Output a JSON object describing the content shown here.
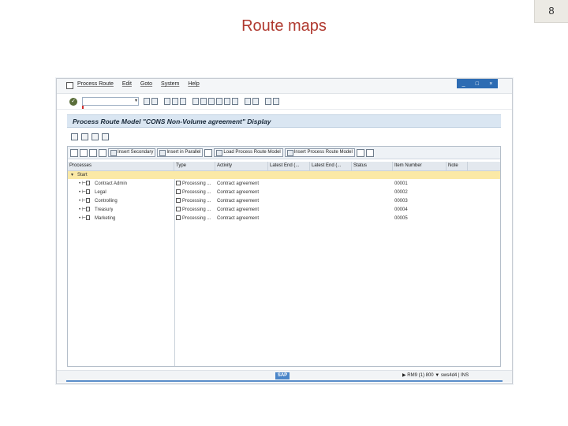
{
  "slide": {
    "title": "Route maps",
    "page_number": "8"
  },
  "menu": {
    "items": [
      "Process Route",
      "Edit",
      "Goto",
      "System",
      "Help"
    ]
  },
  "window": {
    "controls": [
      "_",
      "□",
      "×"
    ]
  },
  "command_field": {
    "value": "",
    "dropdown": "▾"
  },
  "screen": {
    "title": "Process Route Model \"CONS Non-Volume agreement\" Display"
  },
  "panel_buttons": [
    "Insert Secondary",
    "Insert in Parallel",
    "Load Process Route Model",
    "Insert Process Route Model"
  ],
  "columns": [
    "Processes",
    "Type",
    "Activity",
    "Latest End (...",
    "Latest End (...",
    "Status",
    "Item Number",
    "Note"
  ],
  "rows": [
    {
      "process": "Start",
      "level": 0,
      "selected": true,
      "type": "",
      "activity": "",
      "item": ""
    },
    {
      "process": "Contract Admin",
      "level": 1,
      "selected": false,
      "type": "Processing ...",
      "activity": "Contract agreement",
      "item": "00001"
    },
    {
      "process": "Legal",
      "level": 1,
      "selected": false,
      "type": "Processing ...",
      "activity": "Contract agreement",
      "item": "00002"
    },
    {
      "process": "Controlling",
      "level": 1,
      "selected": false,
      "type": "Processing ...",
      "activity": "Contract agreement",
      "item": "00003"
    },
    {
      "process": "Treasury",
      "level": 1,
      "selected": false,
      "type": "Processing ...",
      "activity": "Contract agreement",
      "item": "00004"
    },
    {
      "process": "Marketing",
      "level": 1,
      "selected": false,
      "type": "Processing ...",
      "activity": "Contract agreement",
      "item": "00005"
    }
  ],
  "status": {
    "logo": "SAP",
    "info": "▶ RM9 (1) 800 ▼ sws4d4 | INS"
  }
}
